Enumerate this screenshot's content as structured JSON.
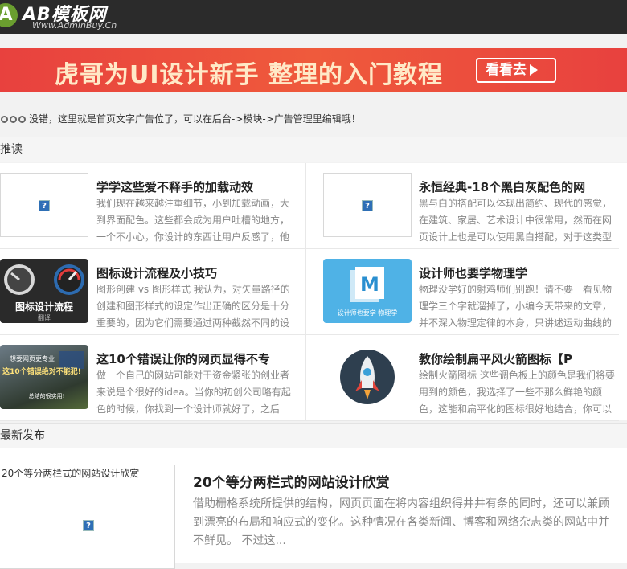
{
  "header": {
    "logo_mark": "A",
    "logo_text": "AB模板网",
    "logo_sub": "Www.AdminBuy.Cn"
  },
  "banner": {
    "title": "虎哥为UI设计新手 整理的入门教程",
    "button_label": "看看去"
  },
  "notice": {
    "text": "没错，这里就是首页文字广告位了，可以在后台->模块->广告管理里编辑哦！"
  },
  "recommend": {
    "heading": "推读",
    "items": [
      {
        "title": "学学这些爱不释手的加载动效",
        "desc": "我们现在越来越注重细节，小到加载动画，大到界面配色。这些都会成为用户吐槽的地方，一个不小心，你设计的东西让用户反感了，他",
        "thumb": "placeholder"
      },
      {
        "title": "永恒经典-18个黑白灰配色的网",
        "desc": "黑与白的搭配可以体现出简约、现代的感觉，在建筑、家居、艺术设计中很常用，然而在网页设计上也是可以使用黑白搭配，对于这类型",
        "thumb": "placeholder"
      },
      {
        "title": "图标设计流程及小技巧",
        "desc": "图形创建 vs 图形样式 我认为，对矢量路径的创建和图形样式的设定作出正确的区分是十分重要的，因为它们需要通过两种截然不同的设",
        "thumb": "icon-design",
        "thumb_title": "图标设计流程",
        "thumb_sub": "翻译"
      },
      {
        "title": "设计师也要学物理学",
        "desc": "物理没学好的射鸡师们别跑！请不要一看见物理学三个字就溜掉了，小编今天带来的文章，并不深入物理定律的本身，只讲述运动曲线的",
        "thumb": "physics",
        "thumb_caption": "设计师也要学 物理学",
        "thumb_letter": "M"
      },
      {
        "title": "这10个错误让你的网页显得不专",
        "desc": "做一个自己的网站可能对于资金紧张的创业者来说是个很好的idea。当你的初创公司略有起色的时候，你找到一个设计师就好了，之后",
        "thumb": "mistakes",
        "thumb_line1": "想要网页更专业",
        "thumb_line2": "这10个错误绝对不能犯!",
        "thumb_line3": "总结的很实用!"
      },
      {
        "title": "教你绘制扁平风火箭图标【P",
        "desc": "绘制火箭图标 这些调色板上的颜色是我们将要用到的颜色，我选择了一些不那么鲜艳的颜色，这能和扁平化的图标很好地结合，你可以",
        "thumb": "rocket"
      }
    ]
  },
  "latest": {
    "heading": "最新发布",
    "thumb_alt": "20个等分两栏式的网站设计欣赏",
    "title": "20个等分两栏式的网站设计欣赏",
    "desc": "借助栅格系统所提供的结构，网页页面在将内容组织得井井有条的同时，还可以兼顾到漂亮的布局和响应式的变化。这种情况在各类新闻、博客和网络杂志类的网站中并不鲜见。 不过这..."
  },
  "placeholder_glyph": "?",
  "colors": {
    "topbar": "#2b2b2b",
    "banner": "#e8413e",
    "accent_green": "#6a9e2f"
  }
}
